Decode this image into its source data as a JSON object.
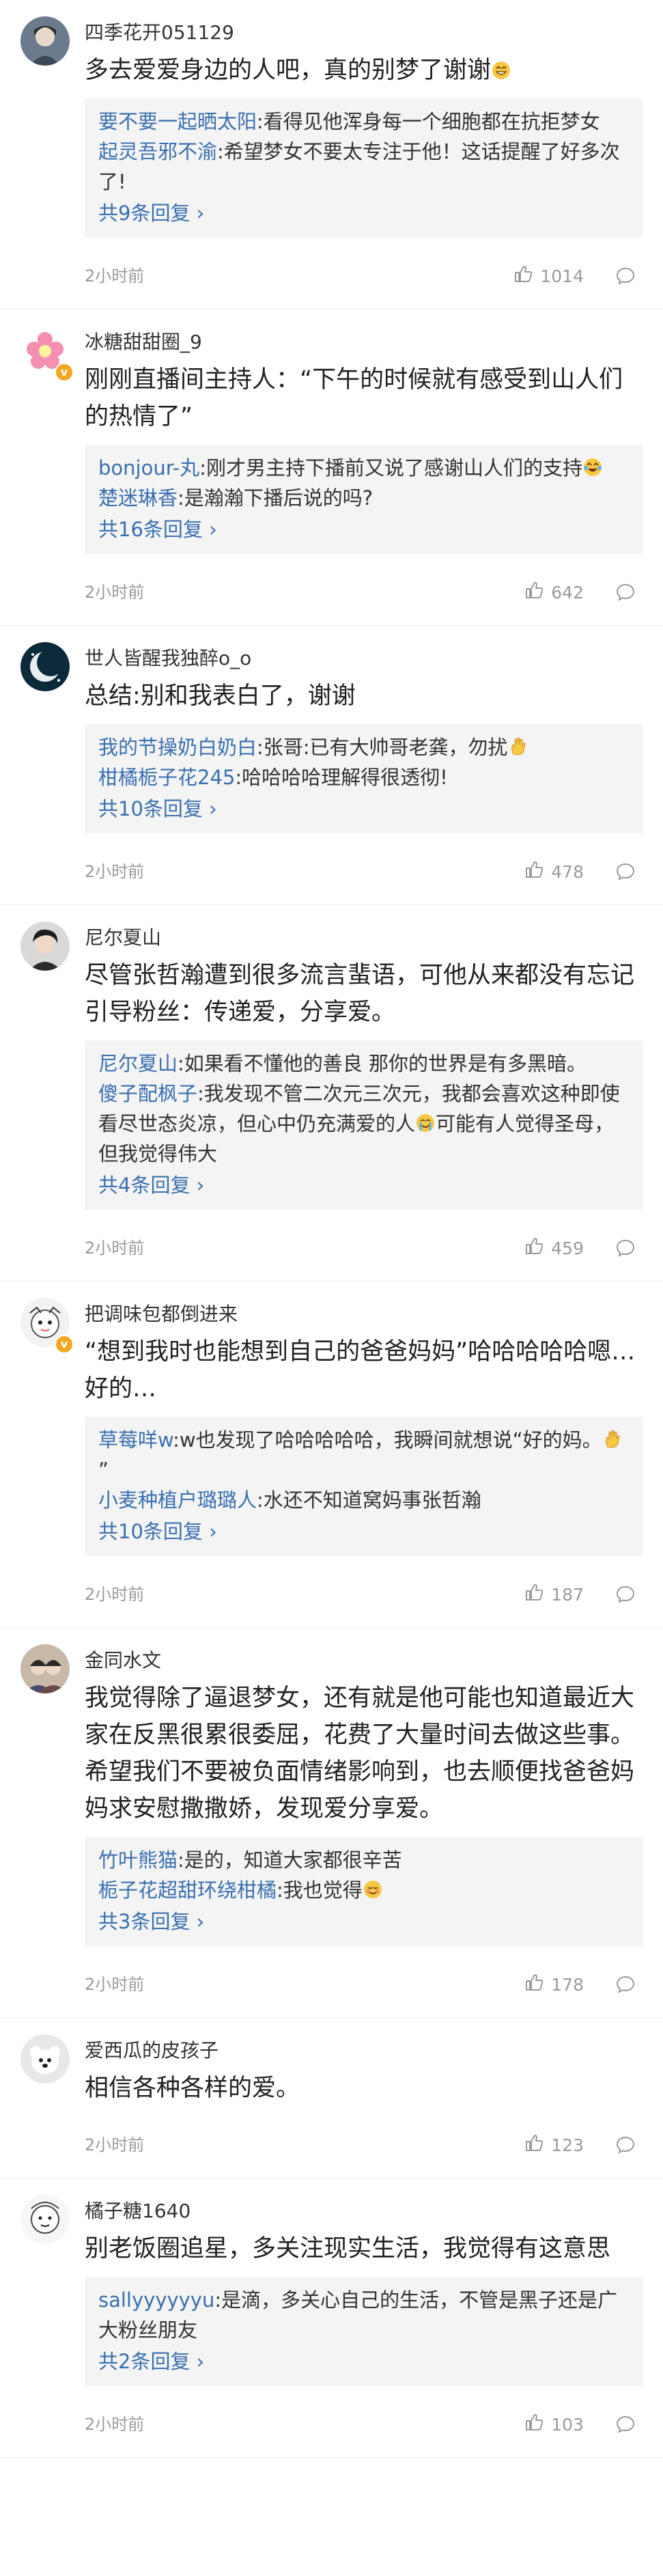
{
  "comments": [
    {
      "username": "四季花开051129",
      "text": "多去爱爱身边的人吧，真的别梦了谢谢",
      "text_emoji": "grin-emoji",
      "replies": [
        {
          "user": "要不要一起晒太阳",
          "text": ":看得见他浑身每一个细胞都在抗拒梦女"
        },
        {
          "user": "起灵吾邪不渝",
          "text": ":希望梦女不要太专注于他！这话提醒了好多次了!"
        }
      ],
      "more_label": "共9条回复",
      "time": "2小时前",
      "likes": "1014"
    },
    {
      "username": "冰糖甜甜圈_9",
      "text": "刚刚直播间主持人：“下午的时候就有感受到山人们的热情了”",
      "replies": [
        {
          "user": "bonjour-丸",
          "text": ":刚才男主持下播前又说了感谢山人们的支持",
          "emoji": "laugh-cry-emoji"
        },
        {
          "user": "楚迷琳香",
          "text": ":是瀚瀚下播后说的吗?"
        }
      ],
      "more_label": "共16条回复",
      "time": "2小时前",
      "likes": "642"
    },
    {
      "username": "世人皆醒我独醉o_o",
      "text": "总结:别和我表白了，谢谢",
      "replies": [
        {
          "user": "我的节操奶白奶白",
          "text": ":张哥:已有大帅哥老龚，勿扰",
          "emoji": "wave-hand-emoji"
        },
        {
          "user": "柑橘栀子花245",
          "text": ":哈哈哈哈理解得很透彻!"
        }
      ],
      "more_label": "共10条回复",
      "time": "2小时前",
      "likes": "478"
    },
    {
      "username": "尼尔夏山",
      "text": "尽管张哲瀚遭到很多流言蜚语，可他从来都没有忘记引导粉丝：传递爱，分享爱。",
      "replies": [
        {
          "user": "尼尔夏山",
          "text": ":如果看不懂他的善良 那你的世界是有多黑暗。"
        },
        {
          "user": "傻子配枫子",
          "text": ":我发现不管二次元三次元，我都会喜欢这种即使看尽世态炎凉，但心中仍充满爱的人",
          "emoji": "tear-smile-emoji",
          "text2": "可能有人觉得圣母，但我觉得伟大"
        }
      ],
      "more_label": "共4条回复",
      "time": "2小时前",
      "likes": "459"
    },
    {
      "username": "把调味包都倒进来",
      "text": "“想到我时也能想到自己的爸爸妈妈”哈哈哈哈哈嗯…好的…",
      "replies": [
        {
          "user": "草莓咩w",
          "text": ":w也发现了哈哈哈哈哈，我瞬间就想说“好的妈。",
          "emoji": "wave-hand-emoji",
          "text2": "”"
        },
        {
          "user": "小麦种植户璐璐人",
          "text": ":水还不知道窝妈事张哲瀚"
        }
      ],
      "more_label": "共10条回复",
      "time": "2小时前",
      "likes": "187"
    },
    {
      "username": "金同水文",
      "text": "我觉得除了逼退梦女，还有就是他可能也知道最近大家在反黑很累很委屈，花费了大量时间去做这些事。希望我们不要被负面情绪影响到，也去顺便找爸爸妈妈求安慰撒撒娇，发现爱分享爱。",
      "replies": [
        {
          "user": "竹叶熊猫",
          "text": ":是的，知道大家都很辛苦"
        },
        {
          "user": "栀子花超甜环绕柑橘",
          "text": ":我也觉得",
          "emoji": "blush-emoji"
        }
      ],
      "more_label": "共3条回复",
      "time": "2小时前",
      "likes": "178"
    },
    {
      "username": "爱西瓜的皮孩子",
      "text": "相信各种各样的爱。",
      "replies": [],
      "more_label": "",
      "time": "2小时前",
      "likes": "123"
    },
    {
      "username": "橘子糖1640",
      "text": "别老饭圈追星，多关注现实生活，我觉得有这意思",
      "replies": [
        {
          "user": "sallyyyyyyu",
          "text": ":是滴，多关心自己的生活，不管是黑子还是广大粉丝朋友"
        }
      ],
      "more_label": "共2条回复",
      "time": "2小时前",
      "likes": "103"
    }
  ],
  "colors": {
    "link": "#3a6fb0",
    "meta": "#9a9a9a",
    "reply_bg": "#f4f4f4",
    "badge": "#f5a623"
  }
}
